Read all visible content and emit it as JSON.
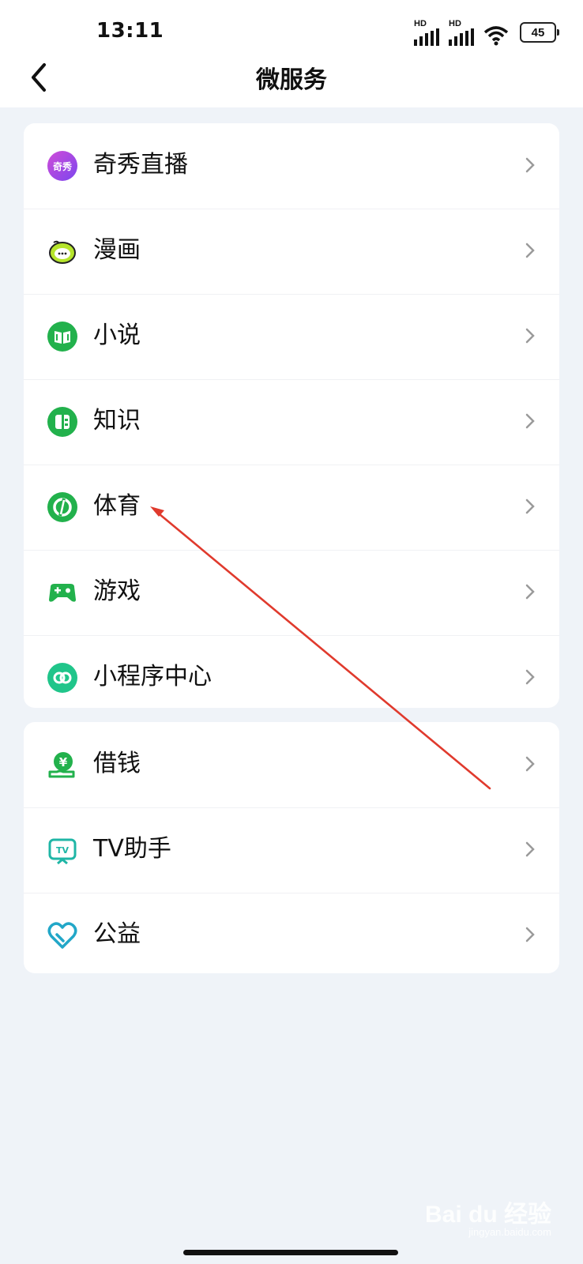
{
  "status": {
    "time": "13:11",
    "hd1": "HD",
    "hd2": "HD",
    "battery": "45"
  },
  "header": {
    "title": "微服务"
  },
  "group1": [
    {
      "label": "奇秀直播",
      "icon": "qixiu-live-icon",
      "icon_text": "奇秀"
    },
    {
      "label": "漫画",
      "icon": "comic-icon"
    },
    {
      "label": "小说",
      "icon": "book-icon"
    },
    {
      "label": "知识",
      "icon": "knowledge-icon"
    },
    {
      "label": "体育",
      "icon": "sports-icon"
    },
    {
      "label": "游戏",
      "icon": "gamepad-icon"
    },
    {
      "label": "小程序中心",
      "icon": "mini-program-icon"
    }
  ],
  "group2": [
    {
      "label": "借钱",
      "icon": "loan-icon",
      "icon_text": "¥"
    },
    {
      "label": "TV助手",
      "icon": "tv-icon",
      "icon_text": "TV"
    },
    {
      "label": "公益",
      "icon": "charity-icon"
    }
  ],
  "colors": {
    "green": "#22b14c",
    "purple": "#a04ae6",
    "arrow": "#e03a2d",
    "background": "#eff3f8"
  },
  "watermark": {
    "text": "Bai du 经验",
    "sub": "jingyan.baidu.com"
  }
}
